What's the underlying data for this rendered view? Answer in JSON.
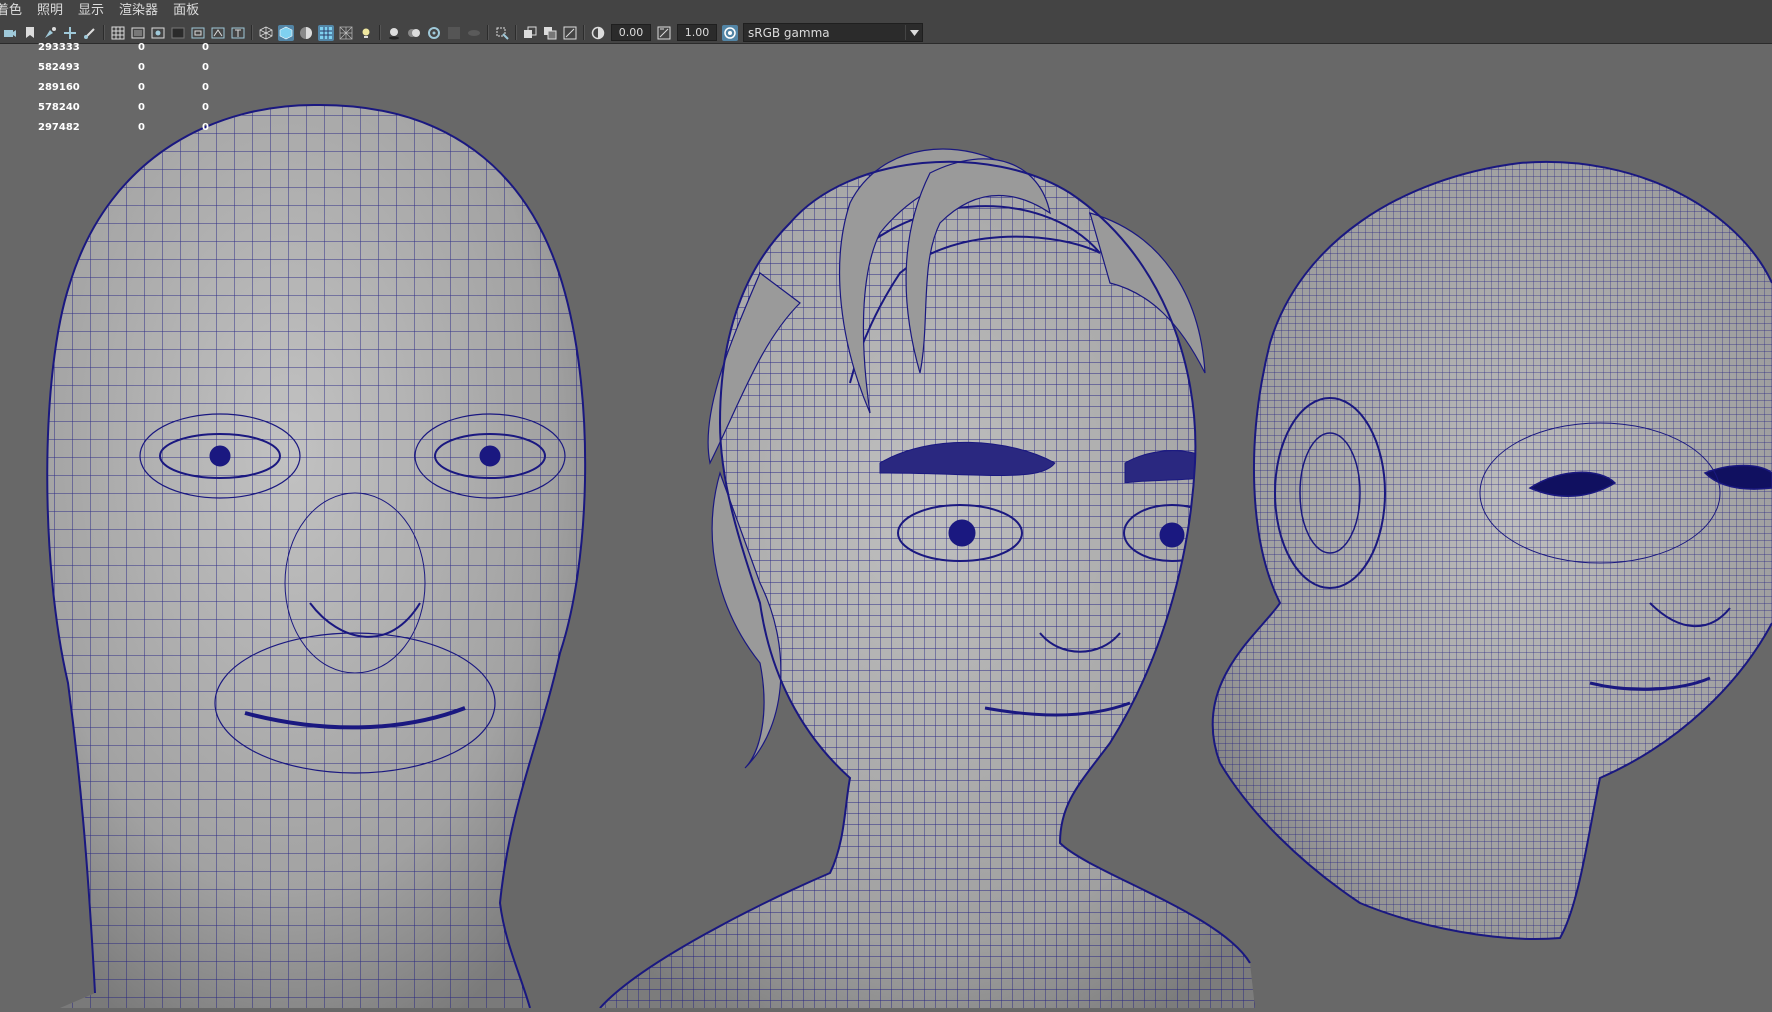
{
  "menubar": {
    "items": [
      "着色",
      "照明",
      "显示",
      "渲染器",
      "面板"
    ]
  },
  "toolbar": {
    "exposure_value": "0.00",
    "gamma_value": "1.00",
    "color_space": "sRGB gamma",
    "icons": [
      "camera-icon",
      "bookmark-icon",
      "paint-icon",
      "move-icon",
      "brush-icon",
      "grid-icon",
      "film-gate-icon",
      "resolution-gate-icon",
      "gate-mask-icon",
      "field-chart-icon",
      "safe-action-icon",
      "safe-title-icon",
      "wireframe-icon",
      "smooth-shade-icon",
      "default-material-icon",
      "wireframe-on-shaded-icon",
      "xray-icon",
      "lights-icon",
      "shadows-icon",
      "ambient-occlusion-icon",
      "motion-blur-icon",
      "isolate-select-icon",
      "xray-joints-icon",
      "xray-components-icon",
      "exposure-icon",
      "gamma-icon",
      "color-management-icon"
    ]
  },
  "hud": {
    "rows": [
      {
        "v1": "293333",
        "v2": "0",
        "v3": "0"
      },
      {
        "v1": "582493",
        "v2": "0",
        "v3": "0"
      },
      {
        "v1": "289160",
        "v2": "0",
        "v3": "0"
      },
      {
        "v1": "578240",
        "v2": "0",
        "v3": "0"
      },
      {
        "v1": "297482",
        "v2": "0",
        "v3": "0"
      }
    ]
  },
  "colors": {
    "viewport_bg": "#686868",
    "wire": "#1a1880",
    "mesh_fill": "#a4a4a4",
    "ui_bg": "#444444",
    "active_accent": "#5285a6"
  }
}
